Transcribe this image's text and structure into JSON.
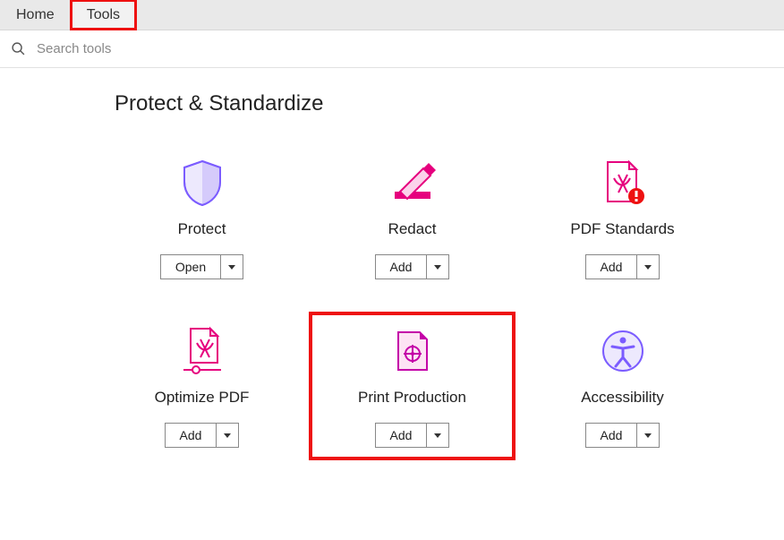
{
  "tabs": {
    "home": "Home",
    "tools": "Tools"
  },
  "search": {
    "placeholder": "Search tools"
  },
  "section": {
    "title": "Protect & Standardize"
  },
  "tools": {
    "protect": {
      "label": "Protect",
      "button": "Open"
    },
    "redact": {
      "label": "Redact",
      "button": "Add"
    },
    "pdf_standards": {
      "label": "PDF Standards",
      "button": "Add"
    },
    "optimize_pdf": {
      "label": "Optimize PDF",
      "button": "Add"
    },
    "print_production": {
      "label": "Print Production",
      "button": "Add"
    },
    "accessibility": {
      "label": "Accessibility",
      "button": "Add"
    }
  }
}
